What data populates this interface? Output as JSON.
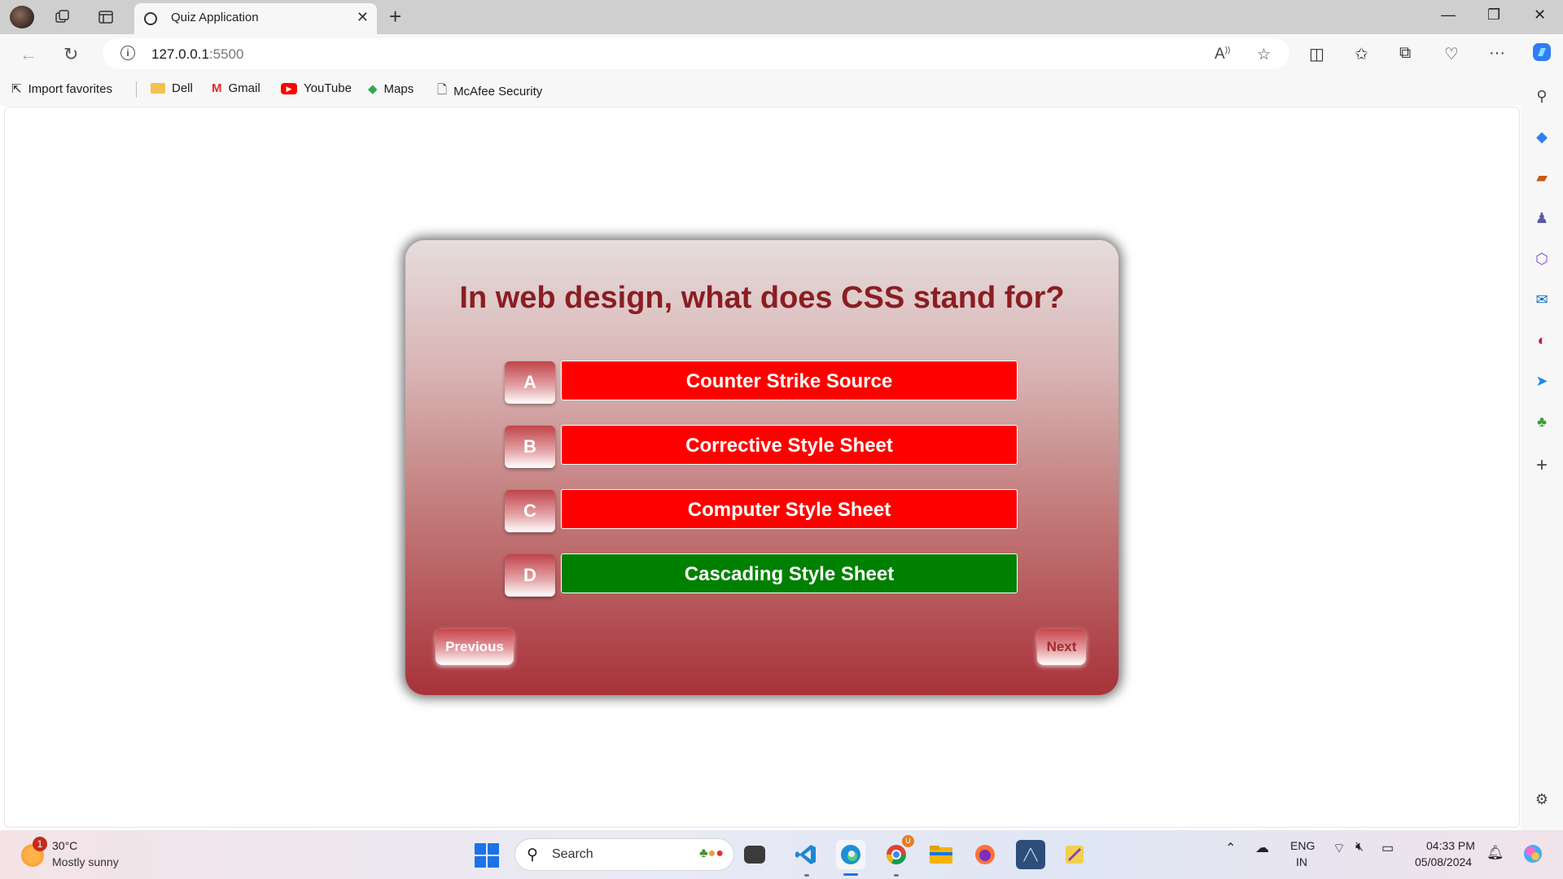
{
  "browser": {
    "tab_title": "Quiz Application",
    "url_host": "127.0.0.1",
    "url_port": ":5500",
    "favorites": [
      {
        "label": "Import favorites",
        "icon": "import-icon"
      },
      {
        "label": "Dell",
        "icon": "folder-icon"
      },
      {
        "label": "Gmail",
        "icon": "gmail-icon"
      },
      {
        "label": "YouTube",
        "icon": "youtube-icon"
      },
      {
        "label": "Maps",
        "icon": "maps-icon"
      },
      {
        "label": "McAfee Security",
        "icon": "page-icon"
      }
    ]
  },
  "quiz": {
    "question": "In web design, what does CSS stand for?",
    "options": [
      {
        "letter": "A",
        "text": "Counter Strike Source",
        "status": "incorrect"
      },
      {
        "letter": "B",
        "text": "Corrective Style Sheet",
        "status": "incorrect"
      },
      {
        "letter": "C",
        "text": "Computer Style Sheet",
        "status": "incorrect"
      },
      {
        "letter": "D",
        "text": "Cascading Style Sheet",
        "status": "correct"
      }
    ],
    "previous_label": "Previous",
    "next_label": "Next",
    "colors": {
      "incorrect": "#ff0000",
      "correct": "#008000",
      "question_text": "#8a1e22"
    }
  },
  "taskbar": {
    "weather_badge": "1",
    "weather_temp": "30°C",
    "weather_desc": "Mostly sunny",
    "search_placeholder": "Search",
    "chrome_badge": "U",
    "lang_line1": "ENG",
    "lang_line2": "IN",
    "time": "04:33 PM",
    "date": "05/08/2024"
  }
}
